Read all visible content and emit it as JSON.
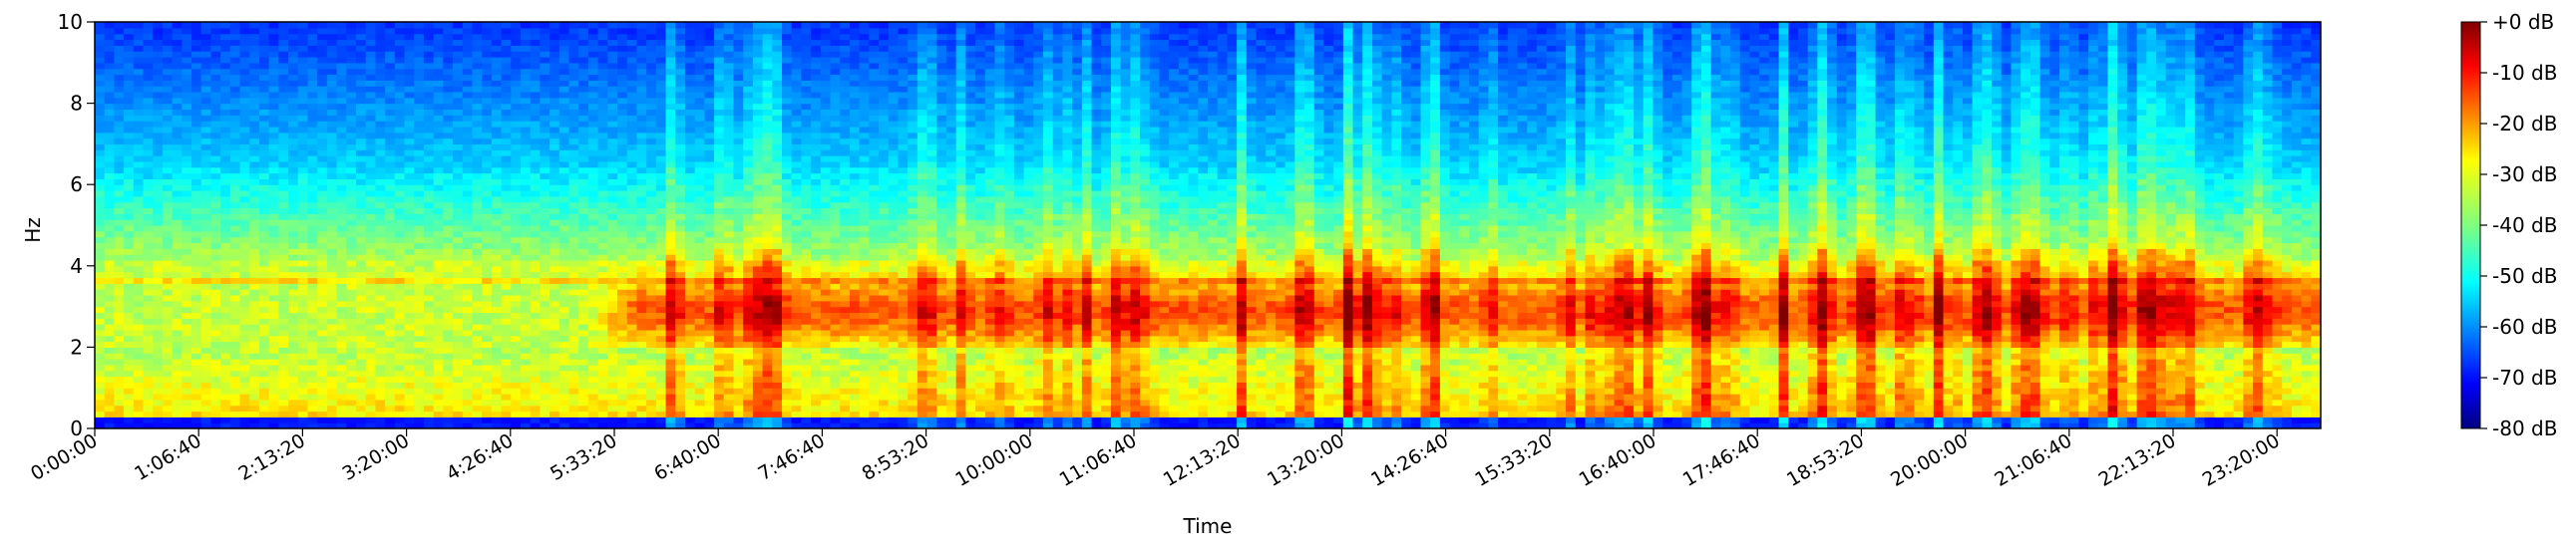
{
  "chart_data": {
    "type": "heatmap",
    "subtype": "spectrogram",
    "title": "",
    "xlabel": "Time",
    "ylabel": "Hz",
    "ylim": [
      0,
      10
    ],
    "yticks": [
      0,
      2,
      4,
      6,
      8,
      10
    ],
    "xticks": [
      "0:00:00",
      "1:06:40",
      "2:13:20",
      "3:20:00",
      "4:26:40",
      "5:33:20",
      "6:40:00",
      "7:46:40",
      "8:53:20",
      "10:00:00",
      "11:06:40",
      "12:13:20",
      "13:20:00",
      "14:26:40",
      "15:33:20",
      "16:40:00",
      "17:46:40",
      "18:53:20",
      "20:00:00",
      "21:06:40",
      "22:13:20",
      "23:20:00"
    ],
    "xlim_seconds": [
      0,
      86400
    ],
    "colormap": "jet",
    "colorbar": {
      "range_db": [
        -80,
        0
      ],
      "ticks": [
        "+0 dB",
        "-10 dB",
        "-20 dB",
        "-30 dB",
        "-40 dB",
        "-50 dB",
        "-60 dB",
        "-70 dB",
        "-80 dB"
      ]
    }
  }
}
